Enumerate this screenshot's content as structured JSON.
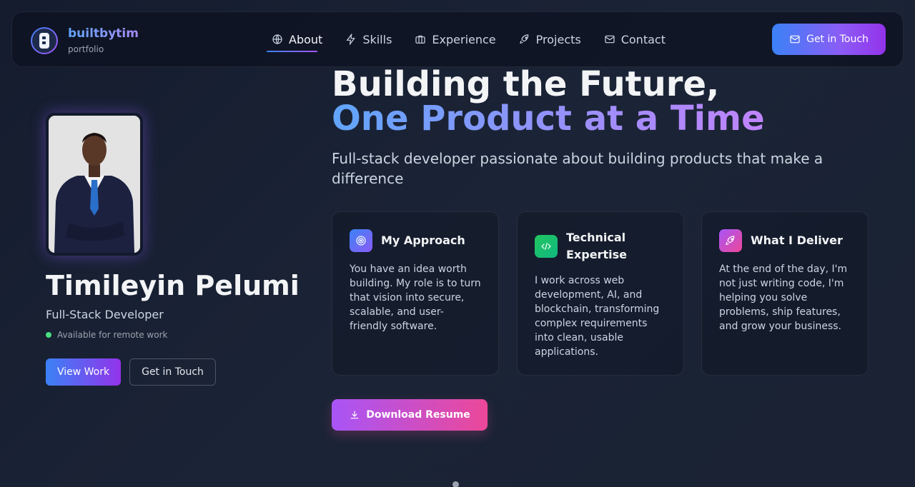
{
  "brand": {
    "name": "builtbytim",
    "subtitle": "portfolio"
  },
  "nav": {
    "items": [
      {
        "label": "About",
        "icon": "globe-icon",
        "active": true
      },
      {
        "label": "Skills",
        "icon": "lightning-icon"
      },
      {
        "label": "Experience",
        "icon": "briefcase-icon"
      },
      {
        "label": "Projects",
        "icon": "rocket-icon"
      },
      {
        "label": "Contact",
        "icon": "mail-icon"
      }
    ],
    "cta_label": "Get in Touch"
  },
  "profile": {
    "name": "Timileyin Pelumi",
    "role": "Full-Stack Developer",
    "availability": "Available for remote work",
    "view_work_label": "View Work",
    "get_in_touch_label": "Get in Touch"
  },
  "hero": {
    "title_line1": "Building the Future,",
    "title_line2": "One Product at a Time",
    "subtitle": "Full-stack developer passionate about building products that make a difference"
  },
  "cards": [
    {
      "title": "My Approach",
      "icon": "target-icon",
      "body": "You have an idea worth building. My role is to turn that vision into secure, scalable, and user-friendly software."
    },
    {
      "title": "Technical Expertise",
      "icon": "code-icon",
      "body": "I work across web development, AI, and blockchain, transforming complex requirements into clean, usable applications."
    },
    {
      "title": "What I Deliver",
      "icon": "rocket-icon",
      "body": "At the end of the day, I'm not just writing code, I'm helping you solve problems, ship features, and grow your business."
    }
  ],
  "resume_label": "Download Resume",
  "colors": {
    "accent_blue": "#3b82f6",
    "accent_purple": "#9333ea",
    "accent_pink": "#ec4899",
    "status_green": "#4ade80",
    "background": "#1b2436"
  }
}
